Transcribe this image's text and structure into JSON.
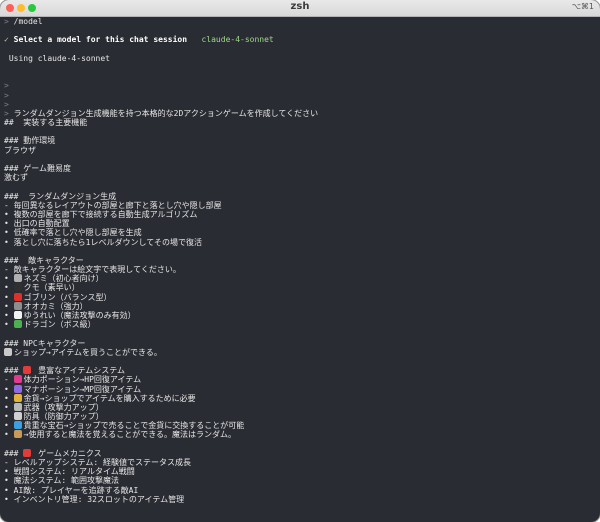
{
  "window": {
    "title": "zsh",
    "shortcut": "⌥⌘1"
  },
  "terminal": {
    "lines": [
      {
        "t": "prompt",
        "text": "/model"
      },
      {
        "t": "blank",
        "text": ""
      },
      {
        "t": "select",
        "text": "Select a model for this chat session",
        "model": "claude-4-sonnet"
      },
      {
        "t": "blank",
        "text": ""
      },
      {
        "t": "plain",
        "text": " Using claude-4-sonnet"
      },
      {
        "t": "blank",
        "text": ""
      },
      {
        "t": "blank",
        "text": ""
      },
      {
        "t": "prompt",
        "text": ""
      },
      {
        "t": "prompt",
        "text": ""
      },
      {
        "t": "prompt",
        "text": ""
      },
      {
        "t": "prompt",
        "text": "ランダムダンジョン生成機能を持つ本格的な2Dアクションゲームを作成してください"
      },
      {
        "t": "plain",
        "text": "##  実装する主要機能"
      },
      {
        "t": "blank",
        "text": ""
      },
      {
        "t": "plain",
        "text": "### 動作環境"
      },
      {
        "t": "plain",
        "text": "ブラウザ"
      },
      {
        "t": "blank",
        "text": ""
      },
      {
        "t": "plain",
        "text": "### ゲーム難易度"
      },
      {
        "t": "plain",
        "text": "激むず"
      },
      {
        "t": "blank",
        "text": ""
      },
      {
        "t": "plain",
        "text": "###  ランダムダンジョン生成"
      },
      {
        "t": "plain",
        "text": "- 毎回異なるレイアウトの部屋と廊下と落とし穴や隠し部屋"
      },
      {
        "t": "plain",
        "text": "• 複数の部屋を廊下で接続する自動生成アルゴリズム"
      },
      {
        "t": "plain",
        "text": "• 出口の自動配置"
      },
      {
        "t": "plain",
        "text": "• 低確率で落とし穴や隠し部屋を生成"
      },
      {
        "t": "plain",
        "text": "• 落とし穴に落ちたら1レベルダウンしてその場で復活"
      },
      {
        "t": "blank",
        "text": ""
      },
      {
        "t": "plain",
        "text": "###  敵キャラクター"
      },
      {
        "t": "plain",
        "text": "- 敵キャラクターは絵文字で表現してください。"
      },
      {
        "t": "icon",
        "icon": "rat-icon",
        "color": "#b0b0b0",
        "prefix": "• ",
        "text": "ネズミ（初心者向け）"
      },
      {
        "t": "icon",
        "icon": "spider-icon",
        "color": "#303030",
        "prefix": "• ",
        "text": "クモ（素早い）"
      },
      {
        "t": "icon",
        "icon": "goblin-icon",
        "color": "#e0302a",
        "prefix": "• ",
        "text": "ゴブリン（バランス型）"
      },
      {
        "t": "icon",
        "icon": "wolf-icon",
        "color": "#8e8e8e",
        "prefix": "• ",
        "text": "オオカミ（強力）"
      },
      {
        "t": "icon",
        "icon": "ghost-icon",
        "color": "#f2f2f2",
        "prefix": "• ",
        "text": "ゆうれい（魔法攻撃のみ有効）"
      },
      {
        "t": "icon",
        "icon": "dragon-icon",
        "color": "#4caf50",
        "prefix": "• ",
        "text": "ドラゴン（ボス級）"
      },
      {
        "t": "blank",
        "text": ""
      },
      {
        "t": "plain",
        "text": "### NPCキャラクター"
      },
      {
        "t": "icon",
        "icon": "shop-icon",
        "color": "#c9c9c9",
        "prefix": "",
        "text": "ショップ→アイテムを買うことができる。"
      },
      {
        "t": "blank",
        "text": ""
      },
      {
        "t": "iconmid",
        "icon": "heart-icon",
        "color": "#e33a3a",
        "prefix": "### ",
        "text": " 豊富なアイテムシステム"
      },
      {
        "t": "icon",
        "icon": "potion-icon",
        "color": "#e33a8f",
        "prefix": "- ",
        "text": "体力ポーション→HP回復アイテム"
      },
      {
        "t": "icon",
        "icon": "mana-icon",
        "color": "#8f6ae3",
        "prefix": "• ",
        "text": "マナポーション→MP回復アイテム"
      },
      {
        "t": "icon",
        "icon": "coin-icon",
        "color": "#e3b23a",
        "prefix": "• ",
        "text": "金貨→ショップでアイテムを購入するために必要"
      },
      {
        "t": "icon",
        "icon": "sword-icon",
        "color": "#b8b8b8",
        "prefix": "• ",
        "text": "武器（攻撃力アップ）"
      },
      {
        "t": "icon",
        "icon": "shield-icon",
        "color": "#d0d0d0",
        "prefix": "• ",
        "text": "防具（防御力アップ）"
      },
      {
        "t": "icon",
        "icon": "gem-icon",
        "color": "#3aa0e3",
        "prefix": "• ",
        "text": "貴重な宝石→ショップで売ることで金貨に交換することが可能"
      },
      {
        "t": "icon",
        "icon": "scroll-icon",
        "color": "#c89a5a",
        "prefix": "• ",
        "text": "→使用すると魔法を覚えることができる。魔法はランダム。"
      },
      {
        "t": "blank",
        "text": ""
      },
      {
        "t": "iconmid",
        "icon": "dart-icon",
        "color": "#e33a3a",
        "prefix": "### ",
        "text": " ゲームメカニクス"
      },
      {
        "t": "plain",
        "text": "- レベルアップシステム: 経験値でステータス成長"
      },
      {
        "t": "plain",
        "text": "• 戦闘システム: リアルタイム戦闘"
      },
      {
        "t": "plain",
        "text": "• 魔法システム: 範囲攻撃魔法"
      },
      {
        "t": "plain",
        "text": "• AI敵: プレイヤーを追跡する敵AI"
      },
      {
        "t": "plain",
        "text": "• インベントリ管理: 32スロットのアイテム管理"
      }
    ]
  }
}
